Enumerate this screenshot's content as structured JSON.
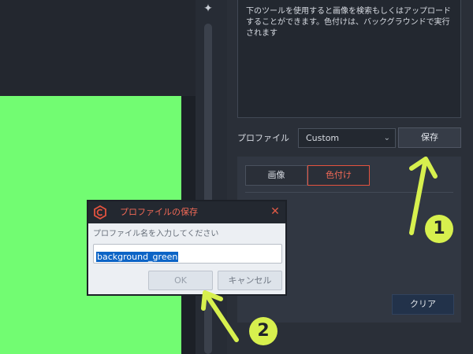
{
  "slider": {
    "icon": "sparkle-icon"
  },
  "panel": {
    "description": "下のツールを使用すると画像を検索もしくはアップロードすることができます。色付けは、バックグラウンドで実行されます",
    "profile_label": "プロファイル",
    "profile_value": "Custom",
    "save_label": "保存",
    "tabs": [
      {
        "label": "画像",
        "active": false
      },
      {
        "label": "色付け",
        "active": true
      }
    ],
    "clear_label": "クリア"
  },
  "dialog": {
    "title": "プロファイルの保存",
    "prompt": "プロファイル名を入力してください",
    "input_value": "background_green",
    "ok_label": "OK",
    "cancel_label": "キャンセル"
  },
  "annotations": {
    "step1": "1",
    "step2": "2",
    "arrow_color": "#d7f04e"
  },
  "colors": {
    "accent": "#e4533f",
    "canvas_green": "#72fc72",
    "selection": "#0c64c6"
  }
}
